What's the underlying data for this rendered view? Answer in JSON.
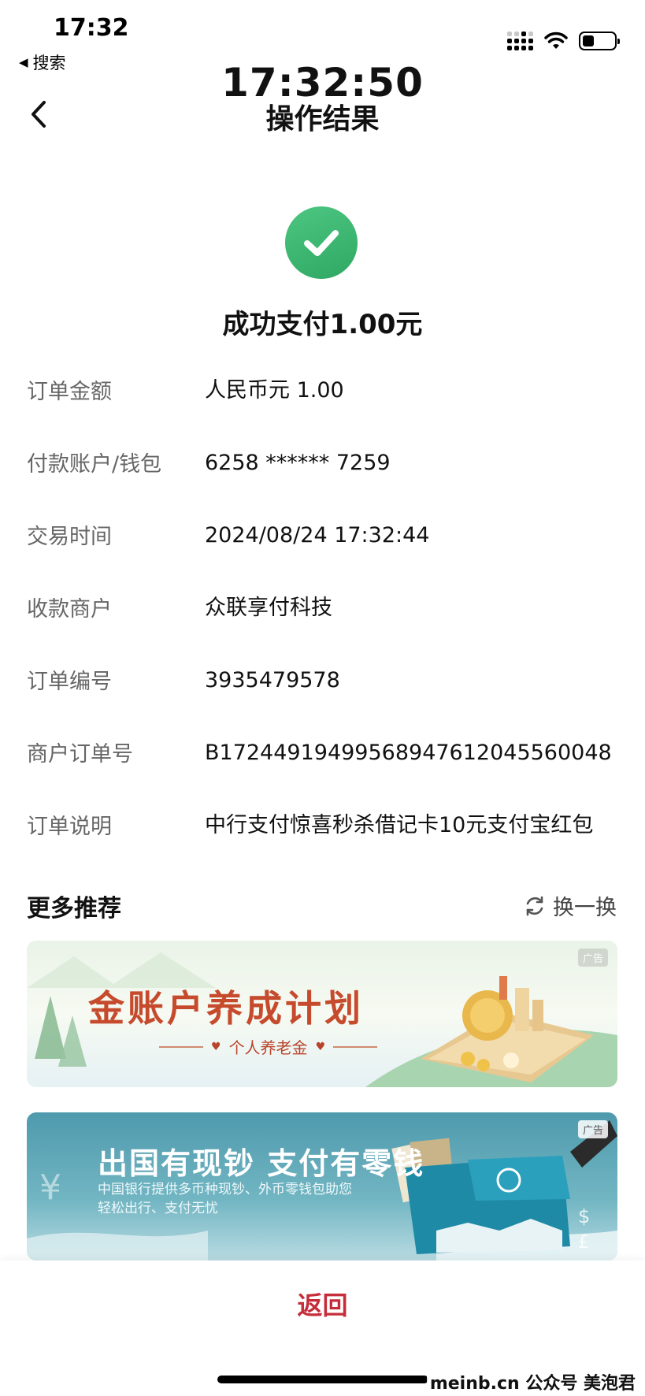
{
  "status_bar": {
    "time": "17:32",
    "back_app": "搜索"
  },
  "header": {
    "clock": "17:32:50",
    "title": "操作结果"
  },
  "result": {
    "title": "成功支付1.00元",
    "accent_color": "#3db671"
  },
  "details": [
    {
      "label": "订单金额",
      "value": "人民币元 1.00"
    },
    {
      "label": "付款账户/钱包",
      "value": "6258 ****** 7259"
    },
    {
      "label": "交易时间",
      "value": "2024/08/24 17:32:44"
    },
    {
      "label": "收款商户",
      "value": "众联享付科技"
    },
    {
      "label": "订单编号",
      "value": "3935479578"
    },
    {
      "label": "商户订单号",
      "value": "B17244919499568947612045560048"
    },
    {
      "label": "订单说明",
      "value": "中行支付惊喜秒杀借记卡10元支付宝红包"
    }
  ],
  "recommend": {
    "title": "更多推荐",
    "refresh_label": "换一换",
    "banners": [
      {
        "ad_label": "广告",
        "title": "金账户养成计划",
        "subtitle": "个人养老金"
      },
      {
        "ad_label": "广告",
        "title": "出国有现钞 支付有零钱",
        "subtitle": "中国银行提供多币种现钞、外币零钱包助您轻松出行、支付无忧"
      }
    ]
  },
  "footer": {
    "return_label": "返回",
    "watermark": "meinb.cn  公众号 美泡君"
  }
}
